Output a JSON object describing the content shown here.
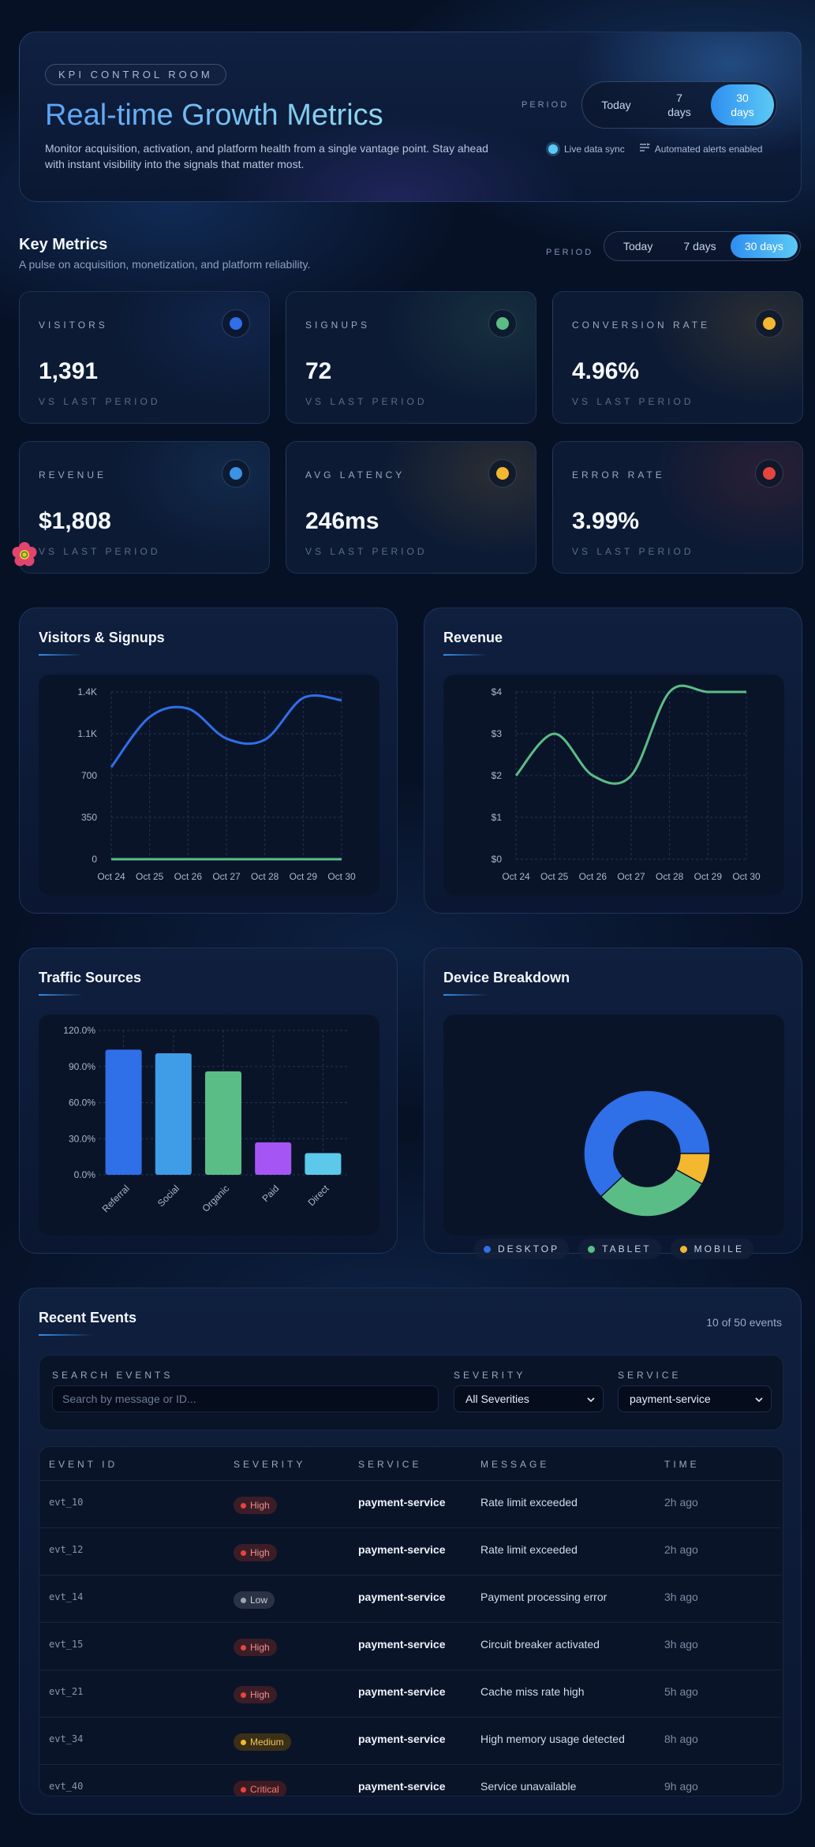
{
  "header": {
    "tag": "KPI CONTROL ROOM",
    "title": "Real-time Growth Metrics",
    "description": "Monitor acquisition, activation, and platform health from a single vantage point. Stay ahead with instant visibility into the signals that matter most.",
    "period_label": "PERIOD",
    "periods": [
      {
        "label": "Today"
      },
      {
        "label": "7",
        "label2": "days"
      },
      {
        "label": "30",
        "label2": "days"
      }
    ],
    "selected_period": "30 days",
    "live_sync": "Live data sync",
    "alerts": "Automated alerts enabled"
  },
  "key_metrics": {
    "title": "Key Metrics",
    "subtitle": "A pulse on acquisition, monetization, and platform reliability.",
    "period_label": "PERIOD",
    "periods": [
      "Today",
      "7 days",
      "30 days"
    ],
    "selected_period": "30 days",
    "cards": [
      {
        "label": "VISITORS",
        "value": "1,391",
        "sub": "VS LAST PERIOD",
        "color": "#2f6fe8"
      },
      {
        "label": "SIGNUPS",
        "value": "72",
        "sub": "VS LAST PERIOD",
        "color": "#5bbd86"
      },
      {
        "label": "CONVERSION RATE",
        "value": "4.96%",
        "sub": "VS LAST PERIOD",
        "color": "#f3b730"
      },
      {
        "label": "REVENUE",
        "value": "$1,808",
        "sub": "VS LAST PERIOD",
        "color": "#3a94e6"
      },
      {
        "label": "AVG LATENCY",
        "value": "246ms",
        "sub": "VS LAST PERIOD",
        "color": "#f3b730"
      },
      {
        "label": "ERROR RATE",
        "value": "3.99%",
        "sub": "VS LAST PERIOD",
        "color": "#e5453e"
      }
    ]
  },
  "charts": {
    "visitors_signups_title": "Visitors & Signups",
    "revenue_title": "Revenue",
    "traffic_title": "Traffic Sources",
    "device_title": "Device Breakdown"
  },
  "chart_data": [
    {
      "type": "line",
      "title": "Visitors & Signups",
      "x": [
        "Oct 24",
        "Oct 25",
        "Oct 26",
        "Oct 27",
        "Oct 28",
        "Oct 29",
        "Oct 30"
      ],
      "yticks": [
        "0",
        "350",
        "700",
        "1.1K",
        "1.4K"
      ],
      "ylim": [
        0,
        1400
      ],
      "series": [
        {
          "values": [
            770,
            1190,
            1260,
            1010,
            1000,
            1350,
            1330
          ],
          "color": "#2f6fe8"
        },
        {
          "values": [
            0,
            0,
            0,
            0,
            0,
            0,
            0
          ],
          "color": "#5bbd86"
        }
      ],
      "grid": true
    },
    {
      "type": "line",
      "title": "Revenue",
      "x": [
        "Oct 24",
        "Oct 25",
        "Oct 26",
        "Oct 27",
        "Oct 28",
        "Oct 29",
        "Oct 30"
      ],
      "yticks": [
        "$0",
        "$1",
        "$2",
        "$3",
        "$4"
      ],
      "ylim": [
        0,
        4
      ],
      "series": [
        {
          "values": [
            2,
            3,
            2,
            2,
            4,
            4,
            4
          ],
          "color": "#5bbd86"
        }
      ],
      "grid": true
    },
    {
      "type": "bar",
      "title": "Traffic Sources",
      "categories": [
        "Referral",
        "Social",
        "Organic",
        "Paid",
        "Direct"
      ],
      "values": [
        104,
        101,
        86,
        27,
        18
      ],
      "colors": [
        "#2f6fe8",
        "#3f9de8",
        "#5bbd86",
        "#a655f5",
        "#5cc9ea"
      ],
      "yticks": [
        "0.0%",
        "30.0%",
        "60.0%",
        "90.0%",
        "120.0%"
      ],
      "ylim": [
        0,
        120
      ],
      "grid": true
    },
    {
      "type": "pie",
      "title": "Device Breakdown",
      "labels": [
        "DESKTOP",
        "TABLET",
        "MOBILE"
      ],
      "values": [
        62,
        30,
        8
      ],
      "colors": [
        "#2f6fe8",
        "#5bbd86",
        "#f3b730"
      ],
      "legend": "bottom"
    }
  ],
  "events": {
    "title": "Recent Events",
    "count": "10 of 50 events",
    "search_label": "SEARCH EVENTS",
    "search_placeholder": "Search by message or ID...",
    "severity_label": "SEVERITY",
    "severity_value": "All Severities",
    "service_label": "SERVICE",
    "service_value": "payment-service",
    "columns": [
      "EVENT ID",
      "SEVERITY",
      "SERVICE",
      "MESSAGE",
      "TIME"
    ],
    "rows": [
      {
        "id": "evt_10",
        "severity": "High",
        "service": "payment-service",
        "message": "Rate limit exceeded",
        "time": "2h ago"
      },
      {
        "id": "evt_12",
        "severity": "High",
        "service": "payment-service",
        "message": "Rate limit exceeded",
        "time": "2h ago"
      },
      {
        "id": "evt_14",
        "severity": "Low",
        "service": "payment-service",
        "message": "Payment processing error",
        "time": "3h ago"
      },
      {
        "id": "evt_15",
        "severity": "High",
        "service": "payment-service",
        "message": "Circuit breaker activated",
        "time": "3h ago"
      },
      {
        "id": "evt_21",
        "severity": "High",
        "service": "payment-service",
        "message": "Cache miss rate high",
        "time": "5h ago"
      },
      {
        "id": "evt_34",
        "severity": "Medium",
        "service": "payment-service",
        "message": "High memory usage detected",
        "time": "8h ago"
      },
      {
        "id": "evt_40",
        "severity": "Critical",
        "service": "payment-service",
        "message": "Service unavailable",
        "time": "9h ago"
      }
    ]
  },
  "severity_colors": {
    "High": {
      "bg": "#3a1d27",
      "fg": "#f0908e",
      "dot": "#e5453e"
    },
    "Low": {
      "bg": "#2a3346",
      "fg": "#c9d2e0",
      "dot": "#9aa6b8"
    },
    "Medium": {
      "bg": "#3a2f17",
      "fg": "#f3c35c",
      "dot": "#f3b730"
    },
    "Critical": {
      "bg": "#3d1a22",
      "fg": "#f07f7c",
      "dot": "#e5453e"
    }
  },
  "widget": {
    "icon": "flower-icon"
  }
}
